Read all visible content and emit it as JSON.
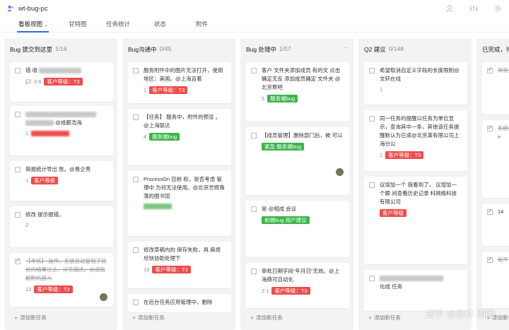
{
  "project": {
    "name": "wt-bug-pc"
  },
  "tabs": [
    {
      "label": "看板视图"
    },
    {
      "label": "甘特图"
    },
    {
      "label": "任务统计"
    },
    {
      "label": "状态"
    },
    {
      "label": "附件"
    }
  ],
  "columns": [
    {
      "title": "Bug 提交到这里",
      "count": "1/16",
      "add_label": "添加新任务",
      "cards": [
        {
          "text": "错 收",
          "meta": "3 6",
          "tag": "客户等级：T3"
        },
        {
          "text": "@成都浩海",
          "meta": "1",
          "tag": ""
        },
        {
          "text": "简报统计导出 败。@易企秀",
          "meta": "1",
          "tag": "客户等级"
        },
        {
          "text": "修改 提示报错。",
          "meta": "2",
          "tag": ""
        },
        {
          "text": "【考核】 操作，系统自动复制了目前的结果过去，详见描述。@湖南超影机器人",
          "meta": "13",
          "tag": "客户等级：T3"
        }
      ]
    },
    {
      "title": "Bug沟通中",
      "count": "0/45",
      "add_label": "添加新任务",
      "cards": [
        {
          "text": "服务附件中的图片无法打开，使用地区：美国。@上海百着",
          "meta": "1",
          "tag": "客户等级：T3"
        },
        {
          "text": "【任务】 服务中，附件的预览 。@上海联达",
          "meta": "4",
          "tag": "服务端bug"
        },
        {
          "text": "ProcessOn 目前 权，是否考虑 管理中 为何无法使用。@北京世辉角落的图书馆",
          "meta": "",
          "tag": ""
        },
        {
          "text": "修改草稿内的 保存失败，具 麻烦尽快协助处理下",
          "meta": "13",
          "tag": "客户等级：T3"
        },
        {
          "text": "在后台任务应用管理中，删除",
          "meta": "",
          "tag": ""
        }
      ]
    },
    {
      "title": "Bug 处理中",
      "count": "1/57",
      "add_label": "添加新任务",
      "cards": [
        {
          "text": "客户 文件夹添加成员 有的文 点击确定无反 添加成员确定 文件夹 @北京帮吧",
          "meta": "5",
          "tag": "服务端bug"
        },
        {
          "text": "【成员管理】删除部门后，被 可以",
          "meta": "",
          "tag": "紧急 服务端bug"
        },
        {
          "text": "是 @相成 会议",
          "meta": "",
          "tag": "前端bug 用户建议"
        },
        {
          "text": "审批日期字段“年月日”无效。@上海鼎可自动化",
          "meta": "2 1",
          "tag": "客户等级：T3"
        }
      ]
    },
    {
      "title": "Q2 建议",
      "count": "0/148",
      "add_label": "添加新任务",
      "cards": [
        {
          "text": "希望取消自定义字段的长度限制@文轩在线",
          "meta": "1",
          "tag": ""
        },
        {
          "text": "同一任务的提醒以任务为单位显示，查询其中一条，其他该任务提醒默认为已读@北京莱有限公司上海分公",
          "meta": "1",
          "tag": "客户等级：T3"
        },
        {
          "text": "议增加一个 我看到了， 议增加一个跟 间查看历史记录 科网络科技有限公司",
          "meta": "",
          "tag": "客户等级"
        },
        {
          "text": "化成 任务",
          "meta": "",
          "tag": ""
        }
      ]
    },
    {
      "title": "已完成，待",
      "count": "",
      "add_label": "添加新任务",
      "cards": [
        {
          "text": "审批 子",
          "meta": "",
          "tag": ""
        },
        {
          "text": "系统 work",
          "meta": "",
          "tag": ""
        },
        {
          "text": "14",
          "meta": "",
          "tag": ""
        },
        {
          "text": "收不",
          "meta": "",
          "tag": ""
        }
      ]
    }
  ],
  "watermark": "知乎 @袁林 图图"
}
